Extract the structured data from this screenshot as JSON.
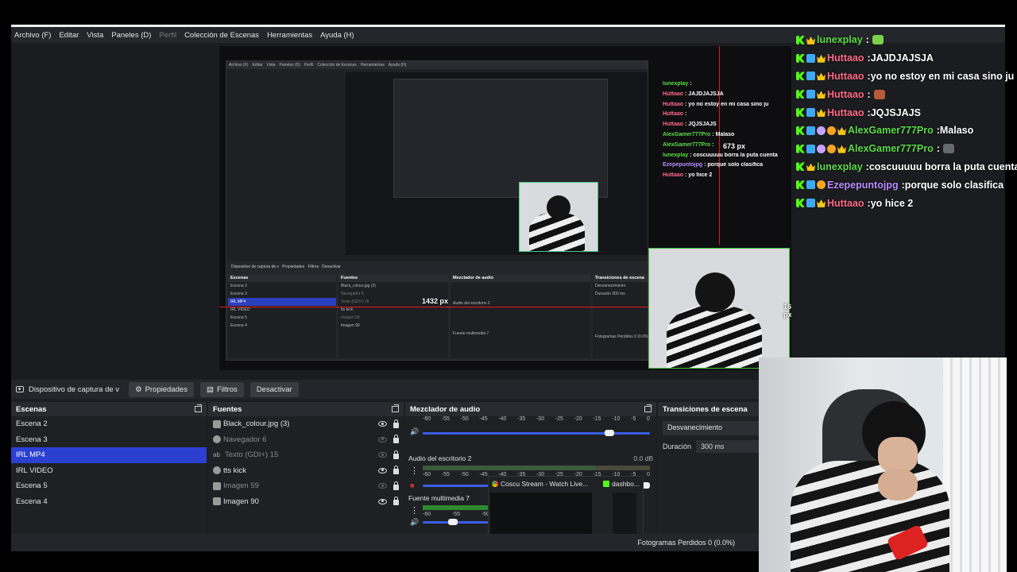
{
  "menu": [
    "Archivo (F)",
    "Editar",
    "Vista",
    "Paneles (D)",
    "Perfil",
    "Colección de Escenas",
    "Herramientas",
    "Ayuda (H)"
  ],
  "source_toolbar": {
    "source_name": "Dispositivo de captura de v",
    "properties": "Propiedades",
    "filters": "Filtros",
    "deactivate": "Desactivar"
  },
  "preview_labels": {
    "width_px": "1432 px",
    "height_px": "673 px",
    "right_px": "16 px"
  },
  "scenes": {
    "title": "Escenas",
    "items": [
      "Escena 2",
      "Escena 3",
      "IRL MP4",
      "IRL VIDEO",
      "Escena 5",
      "Escena 4"
    ],
    "selected": "IRL MP4"
  },
  "sources": {
    "title": "Fuentes",
    "items": [
      {
        "name": "Black_colour.jpg (3)",
        "visible": true
      },
      {
        "name": "Navegador 6",
        "visible": false
      },
      {
        "name": "Texto (GDI+) 15",
        "visible": false
      },
      {
        "name": "tts kick",
        "visible": true
      },
      {
        "name": "Imagen 59",
        "visible": false
      },
      {
        "name": "Imagen 90",
        "visible": true
      }
    ]
  },
  "mixer": {
    "title": "Mezclador de audio",
    "scale": [
      "-60",
      "-55",
      "-50",
      "-45",
      "-40",
      "-35",
      "-30",
      "-25",
      "-20",
      "-15",
      "-10",
      "-5",
      "0"
    ],
    "channels": [
      {
        "name": "",
        "db": "",
        "level": 0.82
      },
      {
        "name": "Audio del escritorio 2",
        "db": "0.0 dB",
        "level": 0.98
      },
      {
        "name": "Fuente multimedia 7",
        "db": "",
        "level": 0.45
      }
    ]
  },
  "transitions": {
    "title": "Transiciones de escena",
    "selected": "Desvanecimiento",
    "duration_label": "Duración",
    "duration_value": "300 ms"
  },
  "status": {
    "dropped_frames": "Fotogramas Perdidos 0 (0.0%)"
  },
  "browser_capture": {
    "tab1": "Coscu Stream - Watch Live...",
    "tab2": "dashbo..."
  },
  "chat": [
    {
      "user": "lunexplay",
      "color": "#5ddc4a",
      "message": "",
      "badges": [
        "b-kick",
        "b-crown"
      ],
      "emote": "#7bd14a"
    },
    {
      "user": "Huttaao",
      "color": "#ff6b8a",
      "message": "JAJDJAJSJA",
      "badges": [
        "b-kick",
        "b-sub",
        "b-crown"
      ],
      "emote": ""
    },
    {
      "user": "Huttaao",
      "color": "#ff6b8a",
      "message": "yo no estoy en mi casa sino ju",
      "badges": [
        "b-kick",
        "b-sub",
        "b-crown"
      ],
      "emote": ""
    },
    {
      "user": "Huttaao",
      "color": "#ff6b8a",
      "message": "",
      "badges": [
        "b-kick",
        "b-sub",
        "b-crown"
      ],
      "emote": "#b85b3a"
    },
    {
      "user": "Huttaao",
      "color": "#ff6b8a",
      "message": "JQJSJAJS",
      "badges": [
        "b-kick",
        "b-sub",
        "b-crown"
      ],
      "emote": ""
    },
    {
      "user": "AlexGamer777Pro",
      "color": "#5ddc4a",
      "message": "Malaso",
      "badges": [
        "b-kick",
        "b-sub",
        "b-star",
        "b-gift",
        "b-crown"
      ],
      "emote": ""
    },
    {
      "user": "AlexGamer777Pro",
      "color": "#5ddc4a",
      "message": "",
      "badges": [
        "b-kick",
        "b-sub",
        "b-star",
        "b-gift",
        "b-crown"
      ],
      "emote": "#666a70"
    },
    {
      "user": "lunexplay",
      "color": "#5ddc4a",
      "message": "coscuuuuu borra la puta cuenta",
      "badges": [
        "b-kick",
        "b-crown"
      ],
      "emote": ""
    },
    {
      "user": "Ezepepuntojpg",
      "color": "#b98cff",
      "message": "porque solo clasifica",
      "badges": [
        "b-kick",
        "b-sub",
        "b-gift"
      ],
      "emote": ""
    },
    {
      "user": "Huttaao",
      "color": "#ff6b8a",
      "message": "yo hice 2",
      "badges": [
        "b-kick",
        "b-sub",
        "b-crown"
      ],
      "emote": ""
    }
  ]
}
